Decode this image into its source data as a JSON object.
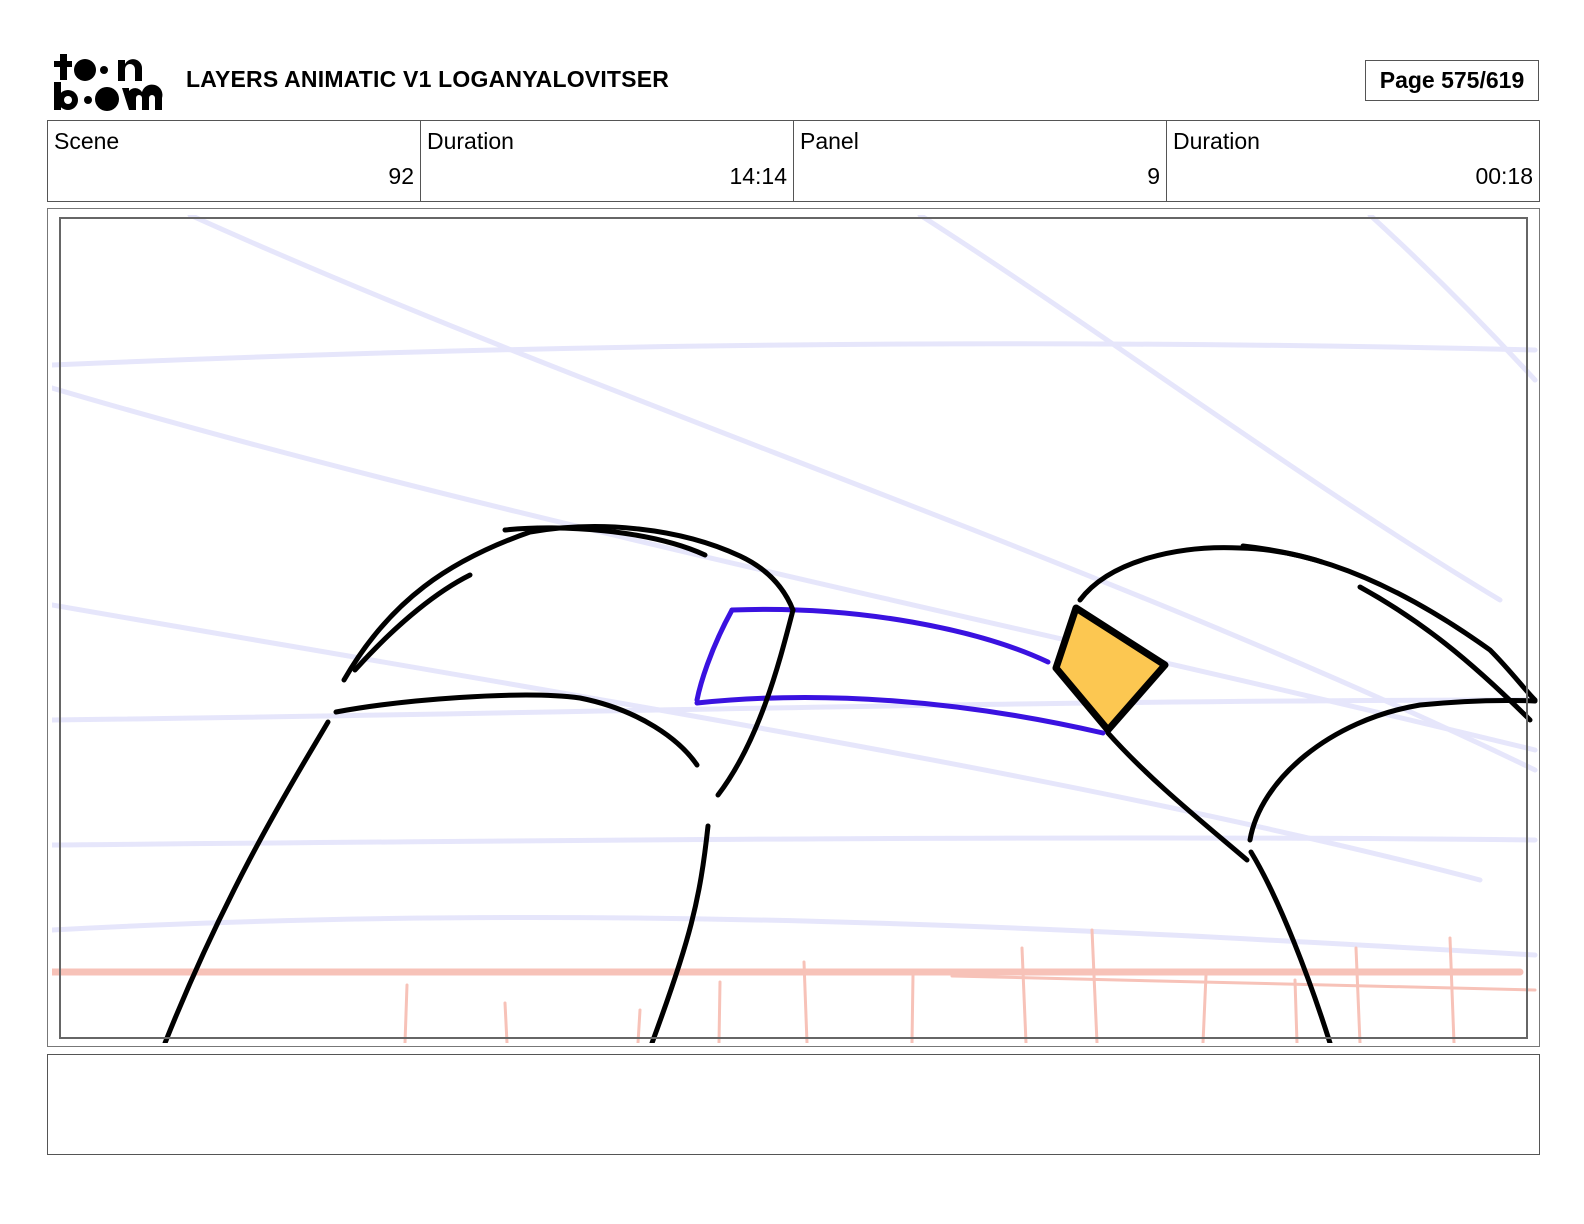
{
  "header": {
    "logo_text": "toon boom",
    "title": "LAYERS ANIMATIC V1 LOGANYALOVITSER",
    "page_label": "Page 575/619"
  },
  "info": {
    "scene_label": "Scene",
    "scene_value": "92",
    "scene_duration_label": "Duration",
    "scene_duration_value": "14:14",
    "panel_label": "Panel",
    "panel_value": "9",
    "panel_duration_label": "Duration",
    "panel_duration_value": "00:18"
  },
  "colors": {
    "guide_lines": "#e6e6fb",
    "ground_line": "#f7c2b8",
    "ink": "#000000",
    "blue_stroke": "#3a12e0",
    "orange_fill": "#fcc751"
  },
  "notes": {
    "text": ""
  }
}
